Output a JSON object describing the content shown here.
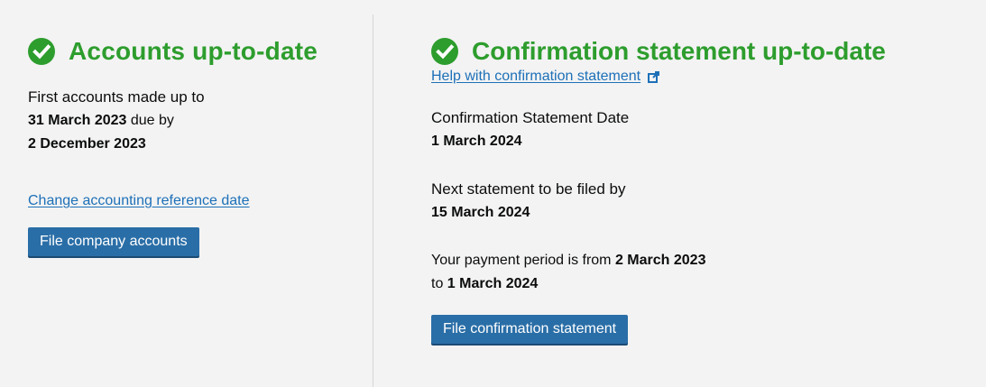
{
  "accounts": {
    "heading": "Accounts up-to-date",
    "line1": "First accounts made up to",
    "made_up_date": "31 March 2023",
    "due_by_label": " due by",
    "due_date": "2 December 2023",
    "change_link": "Change accounting reference date",
    "file_button": "File company accounts"
  },
  "confirmation": {
    "heading": "Confirmation statement up-to-date",
    "help_link": "Help with confirmation statement",
    "statement_date_label": "Confirmation Statement Date",
    "statement_date": "1 March 2024",
    "next_label": "Next statement to be filed by",
    "next_date": "15 March 2024",
    "period_prefix": "Your payment period is from ",
    "period_from": "2 March 2023",
    "period_to_prefix": "to ",
    "period_to": "1 March 2024",
    "file_button": "File confirmation statement"
  },
  "colors": {
    "success_green": "#2d9d2d",
    "link_blue": "#1d70b8",
    "button_blue": "#2a6ea7",
    "background": "#f3f3f3"
  },
  "icons": {
    "heading_icon": "check-circle-icon",
    "help_link_icon": "external-link-icon"
  }
}
